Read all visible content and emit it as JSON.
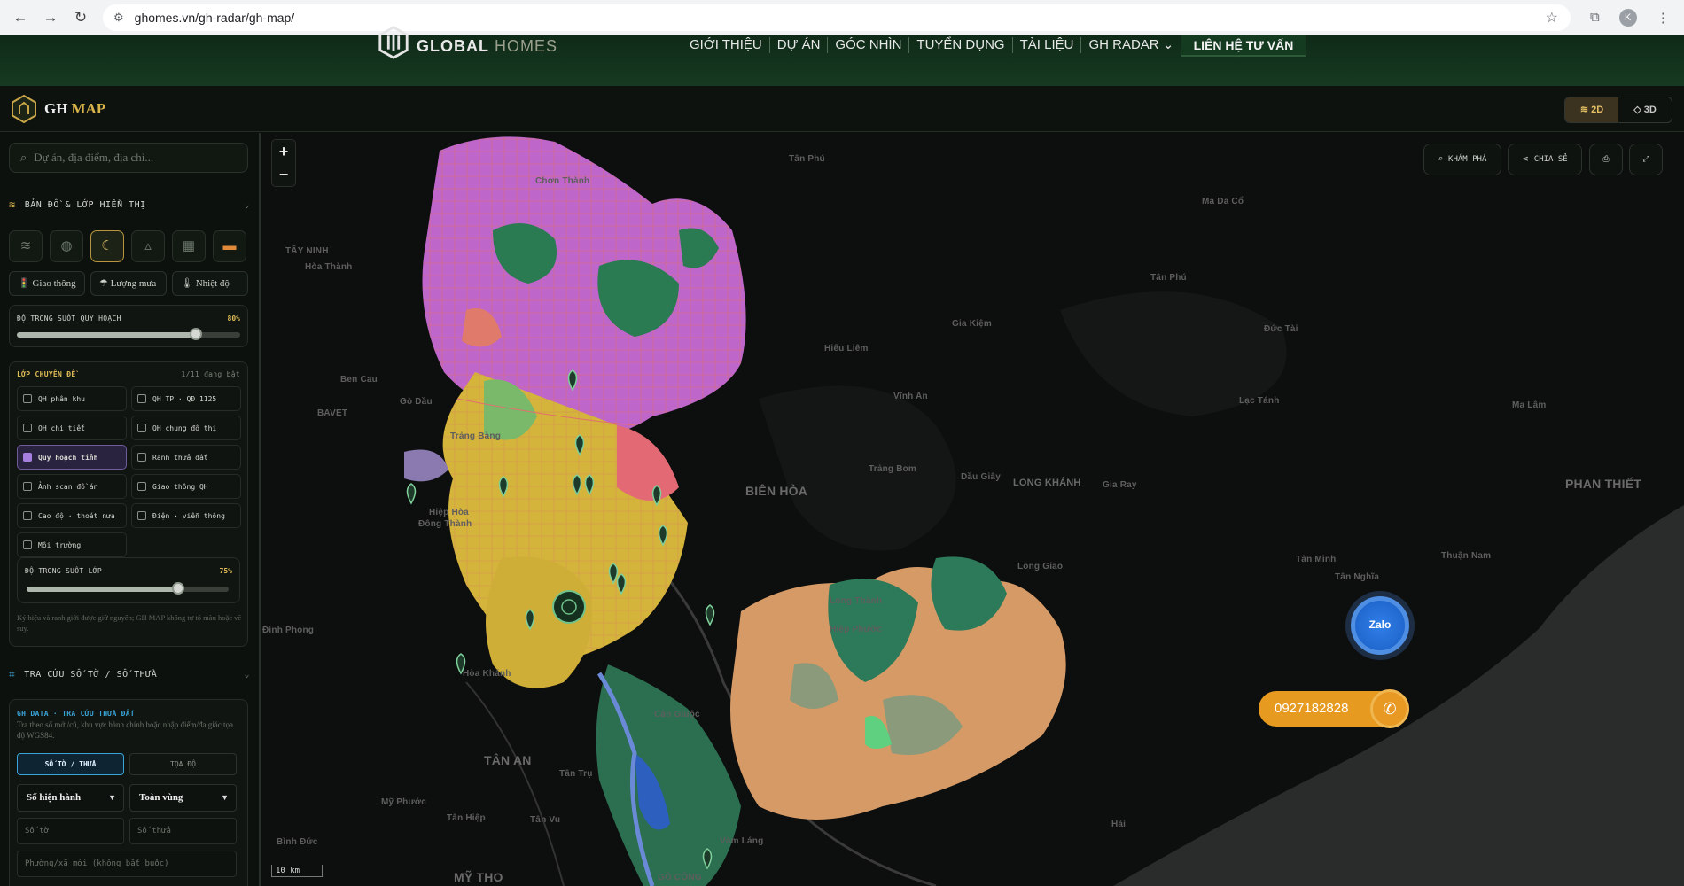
{
  "browser": {
    "url": "ghomes.vn/gh-radar/gh-map/",
    "avatar_letter": "K"
  },
  "site": {
    "logo_word1": "GLOBAL",
    "logo_word2": "HOMES",
    "menu": [
      "GIỚI THIỆU",
      "DỰ ÁN",
      "GÓC NHÌN",
      "TUYỂN DỤNG",
      "TÀI LIỆU",
      "GH RADAR ⌄"
    ],
    "cta": "LIÊN HỆ TƯ VẤN"
  },
  "app": {
    "brand1": "GH",
    "brand2": "MAP",
    "toggle_2d": "2D",
    "toggle_3d": "3D",
    "active_mode": "2D"
  },
  "sidebar": {
    "search_placeholder": "Dự án, địa điểm, địa chỉ...",
    "section_layers_title": "BẢN ĐỒ & LỚP HIỂN THỊ",
    "basemap_icons": [
      "layers-icon",
      "globe-icon",
      "moon-icon",
      "terrain-icon",
      "grid-icon",
      "sunset-icon"
    ],
    "active_basemap": "moon-icon",
    "overlay_pills": [
      "🚦 Giao thông",
      "☂ Lượng mưa",
      "🌡 Nhiệt độ"
    ],
    "planning_opacity": {
      "label": "ĐỘ TRONG SUỐT QUY HOẠCH",
      "value_text": "80%",
      "value": 0.8
    },
    "topic_layers": {
      "title": "LỚP CHUYÊN ĐỀ",
      "count_text": "1/11 đang bật",
      "items": [
        {
          "label": "QH phân khu",
          "checked": false
        },
        {
          "label": "QH TP · QĐ 1125",
          "checked": false
        },
        {
          "label": "QH chi tiết",
          "checked": false
        },
        {
          "label": "QH chung đô thị",
          "checked": false
        },
        {
          "label": "Quy hoạch tỉnh",
          "checked": true
        },
        {
          "label": "Ranh thửa đất",
          "checked": false
        },
        {
          "label": "Ảnh scan đồ án",
          "checked": false
        },
        {
          "label": "Giao thông QH",
          "checked": false
        },
        {
          "label": "Cao độ · thoát nưa",
          "checked": false
        },
        {
          "label": "Điện · viễn thông",
          "checked": false
        },
        {
          "label": "Môi trường",
          "checked": false
        }
      ],
      "layer_opacity": {
        "label": "ĐỘ TRONG SUỐT LỚP",
        "value_text": "75%",
        "value": 0.75
      },
      "note": "Ký hiệu và ranh giới được giữ nguyên; GH MAP không tự tô màu hoặc vẽ suy."
    },
    "section_lookup_title": "TRA CỨU SỐ TỜ / SỐ THỬA",
    "gh_data": {
      "title": "GH DATA · TRA CỨU THỬA ĐẤT",
      "desc": "Tra theo số mới/cũ, khu vực hành chính hoặc nhập điểm/đa giác tọa độ WGS84.",
      "tab_active": "SỐ TỜ / THỬA",
      "tab_other": "TỌA ĐỘ",
      "select1": "Số hiện hành",
      "select2": "Toàn vùng",
      "placeholder_to": "Số tờ",
      "placeholder_thua": "Số thửa",
      "placeholder_ward": "Phường/xã mới (không bắt buộc)"
    }
  },
  "map": {
    "zoom_in": "+",
    "zoom_out": "−",
    "btn_explore": "KHÁM PHÁ",
    "btn_share": "CHIA SẺ",
    "scale_text": "10 km",
    "places": [
      "Tân Phú",
      "Chơn Thành",
      "Ma Da Cổ",
      "TÂY NINH",
      "Hòa Thành",
      "Tân Phú",
      "Hiếu Liêm",
      "Gia Kiệm",
      "Đức Tài",
      "Ben Cau",
      "Gò Dầu",
      "BAVET",
      "Vĩnh An",
      "Lạc Tánh",
      "Ma Lâm",
      "Trảng Bàng",
      "Trảng Bom",
      "Dầu Giây",
      "LONG KHÁNH",
      "Gia Ray",
      "PHAN THIẾT",
      "Hiệp Hòa",
      "Đông Thành",
      "BIÊN HÒA",
      "Tân Minh",
      "Thuận Nam",
      "Long Giao",
      "Tân Nghĩa",
      "Long Thành",
      "Hiệp Phước",
      "Đình Phong",
      "Hòa Khánh",
      "Cần Giuộc",
      "TÂN AN",
      "Tân Trụ",
      "Mỹ Phước",
      "Tân Hiệp",
      "Tân Vu",
      "Bình Đức",
      "Vàm Láng",
      "MỸ THO",
      "GÒ CÔNG",
      "Hải"
    ]
  },
  "contact": {
    "zalo": "Zalo",
    "hotline": "0927182828"
  },
  "colors": {
    "accent_gold": "#d9b24a",
    "site_green": "#163a21",
    "zalo_blue": "#2f7fe8",
    "hotline_orange": "#e69a1f"
  }
}
